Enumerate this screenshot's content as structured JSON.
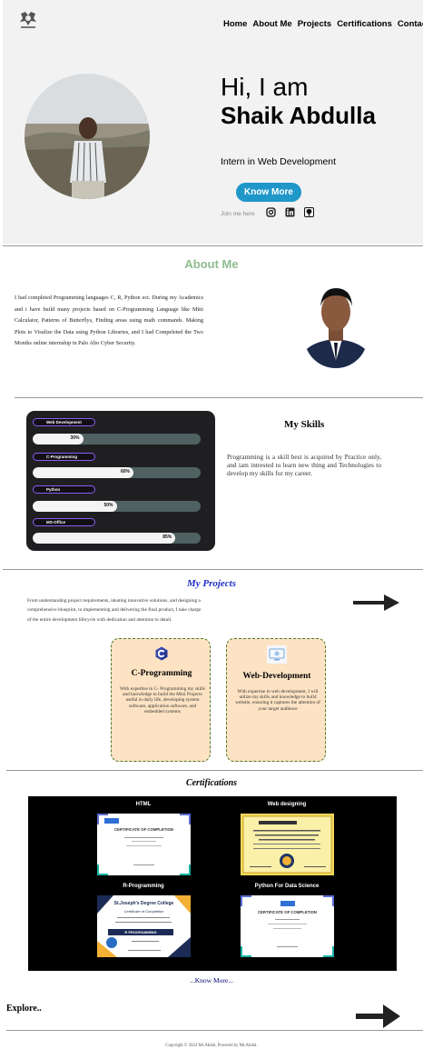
{
  "nav": {
    "items": [
      "Home",
      "About Me",
      "Projects",
      "Certifications",
      "Contact"
    ]
  },
  "hero": {
    "greeting": "Hi, I am",
    "name": "Shaik Abdulla",
    "role": "Intern in Web Development",
    "cta": "Know More",
    "join": "Join me here",
    "social_icons": [
      "instagram-icon",
      "linkedin-icon",
      "github-icon"
    ]
  },
  "about": {
    "title": "About Me",
    "text": "I had completed Programming languages C, R, Python ect. During my Academics and i have build many projects based on C-Programming Language like Mini Calculator, Patterns of Butterflys, Finding areas using math commands. Making Plots to Visulize the Data using Python Libraries, and I had Compeleted the Two Months online internship in Palo Alto Cyber Security."
  },
  "skills": {
    "items": [
      {
        "label": "Web Development",
        "percent": 30,
        "percent_text": "30%"
      },
      {
        "label": "C-Programming",
        "percent": 60,
        "percent_text": "60%"
      },
      {
        "label": "Python",
        "percent": 50,
        "percent_text": "50%"
      },
      {
        "label": "MS-Office",
        "percent": 85,
        "percent_text": "85%"
      }
    ],
    "title": "My Skills",
    "text": "Programming is a skill best is acquired by Practice only, and iam intrested to learn new thing and Technologies to develop my skills for my career."
  },
  "projects": {
    "title": "My Projects",
    "text": "From understanding project requirements, ideating innovative solutions, and designing a comprehensive blueprint, to implementing and delivering the final product, I take charge of the entire development lifecycle with dedication and attention to detail.",
    "cards": [
      {
        "title": "C-Programming",
        "text": "With expertise in C- Programming my skills and knowledge to build the Mini Projects useful in daily life, developing system software, application software, and embedded systems"
      },
      {
        "title": "Web-Development",
        "text": "With expertise in web development, I will utilize my skills and knowledge to build website, ensuring it captures the attention of your target audience"
      }
    ]
  },
  "certifications": {
    "title": "Certifications",
    "items": [
      "HTML",
      "Web designing",
      "R-Programming",
      "Python For Data Science"
    ],
    "cert_heading": "CERTIFICATE OF COMPLETION",
    "college": "St.Joseph's Degree College",
    "cert_sub": "Certificate of Completion",
    "r_banner": "R PROGRAMMING",
    "know_more": "...Know More..."
  },
  "explore": "Explore..",
  "footer": "Copyright © 2024 Mr.Abdul. Powered by Mr.Abdul."
}
